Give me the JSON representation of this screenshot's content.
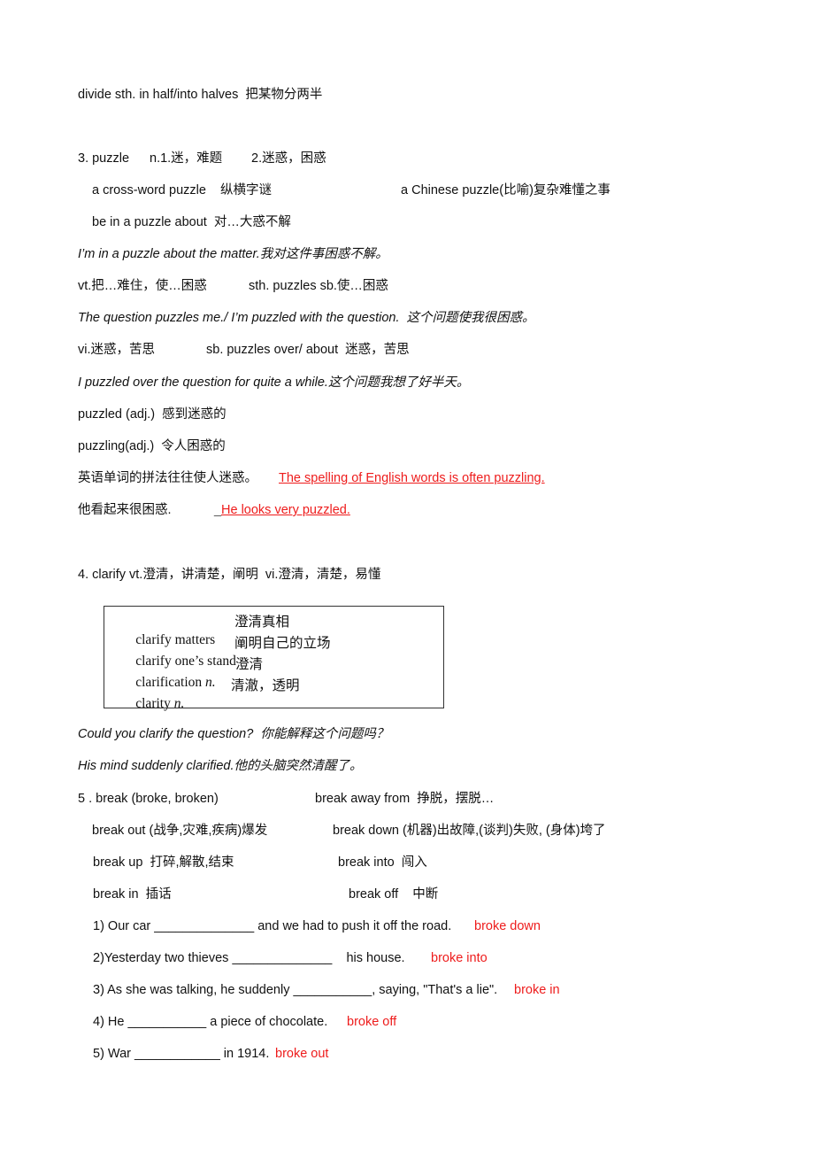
{
  "lines": {
    "divide": "divide sth. in half/into halves  把某物分两半",
    "puzzle_head_a": "3. puzzle",
    "puzzle_head_b": "n.1.迷，难题",
    "puzzle_head_c": "2.迷惑，困惑",
    "crossword": "a cross-word puzzle    纵横字谜",
    "chinese_puzzle": "a Chinese puzzle(比喻)复杂难懂之事",
    "be_in_puzzle": "be in a puzzle about  对…大惑不解",
    "ex1": "I’m in a puzzle about the matter.我对这件事困惑不解。",
    "vt_a": "vt.把…难住，使…困惑",
    "vt_b": "sth. puzzles sb.使…困惑",
    "ex2": "The question puzzles me./ I’m puzzled with the question.  这个问题使我很困惑。",
    "vi_a": "vi.迷惑，苦思",
    "vi_b": "sb. puzzles over/ about  迷惑，苦思",
    "ex3": "I puzzled over the question for quite a while.这个问题我想了好半天。",
    "puzzled": "puzzled (adj.)  感到迷惑的",
    "puzzling": "puzzling(adj.)  令人困惑的",
    "trans1_cn": "英语单词的拼法往往使人迷惑。",
    "trans1_en": "The spelling of English words is often puzzling.",
    "trans2_cn": "他看起来很困惑.",
    "trans2_blank": "_",
    "trans2_en": "He looks very puzzled.",
    "clarify_head": "4. clarify vt.澄清，讲清楚，阐明  vi.澄清，清楚，易懂",
    "ex4": "Could you clarify the question?  你能解释这个问题吗？",
    "ex5": "His mind suddenly clarified.他的头脑突然清醒了。",
    "break_head": "5 . break (broke, broken)",
    "break_away": "break away from  挣脱，摆脱…",
    "break_out": "break out (战争,灾难,疾病)爆发",
    "break_down": "break down (机器)出故障,(谈判)失败, (身体)垮了",
    "break_up": "break up  打碎,解散,结束",
    "break_into": "break into  闯入",
    "break_in": "break in  插话",
    "break_off": "break off    中断"
  },
  "clarify_box": [
    {
      "en": "clarify matters",
      "pos": "",
      "cn": "澄清真相"
    },
    {
      "en": "clarify one’s stand",
      "pos": "",
      "cn": "阐明自己的立场"
    },
    {
      "en": "clarification ",
      "pos": "n.",
      "cn": "澄清"
    },
    {
      "en": "clarity ",
      "pos": "n.",
      "cn": "清澈，透明"
    }
  ],
  "exercises": [
    {
      "q": "1) Our car ______________ and we had to push it off the road.",
      "a": "broke down"
    },
    {
      "q": "2)Yesterday two thieves ______________    his house.",
      "a": "broke into"
    },
    {
      "q": "3) As she was talking, he suddenly ___________, saying, \"That's a lie\".",
      "a": "broke in"
    },
    {
      "q": "4) He ___________ a piece of chocolate.",
      "a": "broke off"
    },
    {
      "q": "5) War ____________ in 1914.",
      "a": "broke out"
    }
  ],
  "colors": {
    "answer": "#ee1c1c",
    "text": "#111111"
  }
}
